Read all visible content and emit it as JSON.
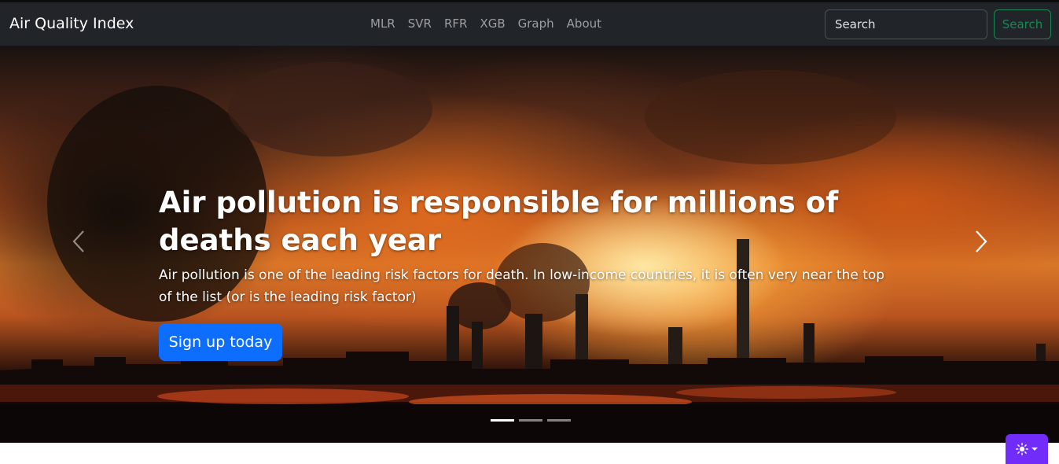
{
  "navbar": {
    "brand": "Air Quality Index",
    "links": [
      {
        "label": "MLR"
      },
      {
        "label": "SVR"
      },
      {
        "label": "RFR"
      },
      {
        "label": "XGB"
      },
      {
        "label": "Graph"
      },
      {
        "label": "About"
      }
    ],
    "search": {
      "placeholder": "Search",
      "button_label": "Search"
    }
  },
  "hero": {
    "heading": "Air pollution is responsible for millions of deaths each year",
    "text": "Air pollution is one of the leading risk factors for death. In low-income countries, it is often very near the top of the list (or is the leading risk factor)",
    "cta_label": "Sign up today",
    "slides_total": 3,
    "active_slide": 1,
    "prev_icon": "chevron-left-icon",
    "next_icon": "chevron-right-icon"
  },
  "theme_toggle": {
    "icon": "sun-icon",
    "accent": "#712cf9"
  },
  "colors": {
    "navbar_bg": "#212529",
    "primary": "#0d6efd",
    "success": "#198754"
  }
}
